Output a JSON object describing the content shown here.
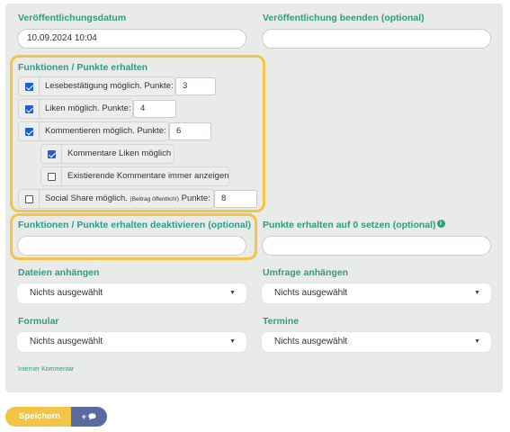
{
  "publish": {
    "label": "Veröffentlichungsdatum",
    "value": "10.09.2024 10:04"
  },
  "end_publish": {
    "label": "Veröffentlichung beenden (optional)",
    "value": ""
  },
  "functions": {
    "label": "Funktionen / Punkte erhalten",
    "read": {
      "label": "Lesebestätigung möglich. Punkte:",
      "points": "3",
      "checked": true
    },
    "like": {
      "label": "Liken möglich. Punkte:",
      "points": "4",
      "checked": true
    },
    "comment": {
      "label": "Kommentieren möglich. Punkte:",
      "points": "6",
      "checked": true
    },
    "comment_like": {
      "label": "Kommentare Liken möglich",
      "checked": true
    },
    "comment_show": {
      "label": "Existierende Kommentare immer anzeigen",
      "checked": false
    },
    "share": {
      "label": "Social Share möglich.",
      "note": "(Beitrag öffentlich!)",
      "suffix": "Punkte:",
      "points": "8",
      "checked": false
    }
  },
  "deactivate": {
    "label": "Funktionen / Punkte erhalten deaktivieren (optional)",
    "value": ""
  },
  "zero_points": {
    "label": "Punkte erhalten auf 0 setzen (optional)",
    "info_icon": "info-icon",
    "value": ""
  },
  "attach_files": {
    "label": "Dateien anhängen",
    "value": "Nichts ausgewählt"
  },
  "attach_survey": {
    "label": "Umfrage anhängen",
    "value": "Nichts ausgewählt"
  },
  "form": {
    "label": "Formular",
    "value": "Nichts ausgewählt"
  },
  "dates": {
    "label": "Termine",
    "value": "Nichts ausgewählt"
  },
  "internal_comment": {
    "label": "Interner Kommentar"
  },
  "actions": {
    "save": "Speichern",
    "comment": "+",
    "comment_icon": "speech-bubble-icon"
  },
  "colors": {
    "accent": "#2e9c83",
    "highlight": "#f3c547",
    "save": "#f3c547",
    "comment_button": "#5b6ba1",
    "checkbox": "#1f5fd6"
  }
}
